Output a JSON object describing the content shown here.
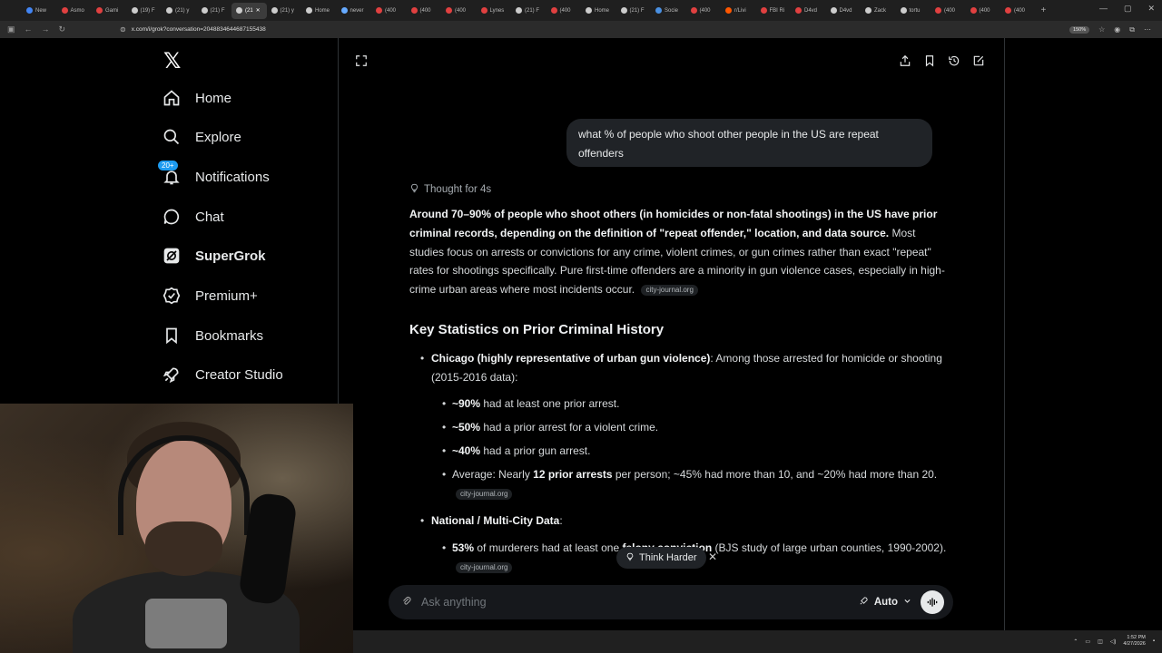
{
  "browser": {
    "tabs": [
      {
        "label": "New",
        "color": "#4285f4"
      },
      {
        "label": "Asmo",
        "color": "#e04040"
      },
      {
        "label": "Gami",
        "color": "#e04040"
      },
      {
        "label": "(19) F",
        "color": "#cccccc"
      },
      {
        "label": "(21) y",
        "color": "#cccccc"
      },
      {
        "label": "(21) F",
        "color": "#cccccc"
      },
      {
        "label": "(21",
        "color": "#cccccc",
        "active": true
      },
      {
        "label": "(21) y",
        "color": "#cccccc"
      },
      {
        "label": "Home",
        "color": "#cccccc"
      },
      {
        "label": "never",
        "color": "#66aaff"
      },
      {
        "label": "(400",
        "color": "#e04040"
      },
      {
        "label": "(400",
        "color": "#e04040"
      },
      {
        "label": "(400",
        "color": "#e04040"
      },
      {
        "label": "Lynes",
        "color": "#e04040"
      },
      {
        "label": "(21) F",
        "color": "#cccccc"
      },
      {
        "label": "(400",
        "color": "#e04040"
      },
      {
        "label": "Home",
        "color": "#cccccc"
      },
      {
        "label": "(21) F",
        "color": "#cccccc"
      },
      {
        "label": "Socie",
        "color": "#4a90e2"
      },
      {
        "label": "(400",
        "color": "#e04040"
      },
      {
        "label": "r/Livi",
        "color": "#ff5700"
      },
      {
        "label": "FBI Ri",
        "color": "#e04040"
      },
      {
        "label": "D4vd",
        "color": "#e04040"
      },
      {
        "label": "D4vd",
        "color": "#cccccc"
      },
      {
        "label": "Zack",
        "color": "#cccccc"
      },
      {
        "label": "tortu",
        "color": "#cccccc"
      },
      {
        "label": "(400",
        "color": "#e04040"
      },
      {
        "label": "(400",
        "color": "#e04040"
      },
      {
        "label": "(400",
        "color": "#e04040"
      }
    ],
    "url": "x.com/i/grok?conversation=2048834644687155438",
    "zoom": "150%"
  },
  "sidebar": {
    "items": [
      {
        "label": "Home",
        "icon": "home-icon"
      },
      {
        "label": "Explore",
        "icon": "search-icon"
      },
      {
        "label": "Notifications",
        "icon": "bell-icon",
        "badge": "20+"
      },
      {
        "label": "Chat",
        "icon": "chat-icon"
      },
      {
        "label": "SuperGrok",
        "icon": "grok-icon"
      },
      {
        "label": "Premium+",
        "icon": "verified-icon"
      },
      {
        "label": "Bookmarks",
        "icon": "bookmark-icon"
      },
      {
        "label": "Creator Studio",
        "icon": "rocket-icon"
      }
    ]
  },
  "conversation": {
    "user_message": "what % of people who shoot other people in the US are repeat offenders",
    "thought_label": "Thought for 4s",
    "intro_bold": "Around 70–90% of people who shoot others (in homicides or non-fatal shootings) in the US have prior criminal records, depending on the definition of \"repeat offender,\" location, and data source.",
    "intro_rest": " Most studies focus on arrests or convictions for any crime, violent crimes, or gun crimes rather than exact \"repeat\" rates for shootings specifically. Pure first-time offenders are a minority in gun violence cases, especially in high-crime urban areas where most incidents occur.",
    "cite_1": "city-journal.org",
    "heading": "Key Statistics on Prior Criminal History",
    "chicago_bold": "Chicago (highly representative of urban gun violence)",
    "chicago_rest": ": Among those arrested for homicide or shooting (2015-2016 data):",
    "s1_bold": "~90%",
    "s1_rest": " had at least one prior arrest.",
    "s2_bold": "~50%",
    "s2_rest": " had a prior arrest for a violent crime.",
    "s3_bold": "~40%",
    "s3_rest": " had a prior gun arrest.",
    "s4_a": "Average: Nearly ",
    "s4_bold": "12 prior arrests",
    "s4_rest": " per person; ~45% had more than 10, and ~20% had more than 20.",
    "cite_2": "city-journal.org",
    "national_bold": "National / Multi-City Data",
    "national_rest": ":",
    "n1_bold": "53%",
    "n1_mid": " of murderers had at least one ",
    "n1_bold2": "felony conviction",
    "n1_rest": " (BJS study of large urban counties, 1990-2002).",
    "cite_3": "city-journal.org"
  },
  "think_harder": "Think Harder",
  "composer": {
    "placeholder": "Ask anything",
    "model": "Auto"
  },
  "system": {
    "time": "1:52 PM",
    "date": "4/27/2026"
  }
}
